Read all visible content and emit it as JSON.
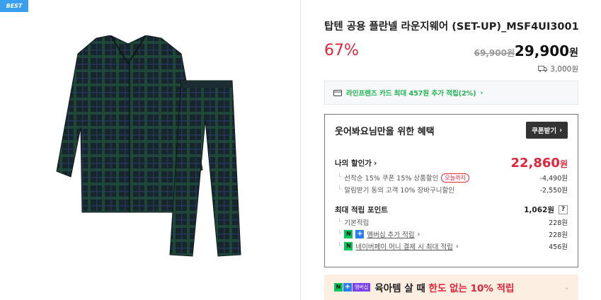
{
  "badge": "BEST",
  "product": {
    "title": "탑텐 공용 플란넬 라운지웨어 (SET-UP)_MSF4UI3001",
    "discount": "67%",
    "original_price": "69,900원",
    "sale_price": "29,900",
    "sale_price_unit": "원",
    "delivery_fee": "3,000원",
    "delivery_icon": "truck-icon"
  },
  "card_promo": {
    "text": "라인프렌즈 카드 최대 457원 추가 적립(2%)",
    "chevron": "›",
    "icon": "credit-card-icon"
  },
  "benefit": {
    "title": "웃어봐요님만을 위한 혜택",
    "coupon_button": "쿠폰받기",
    "coupon_chevron": "›",
    "my_discount_label": "나의 할인가",
    "my_discount_chevron": "›",
    "my_discount_price": "22,860",
    "my_discount_unit": "원",
    "discount_items": [
      {
        "label": "선착순 15% 쿠폰 15% 상품할인",
        "tag": "오늘까지",
        "value": "-4,490원"
      },
      {
        "label": "알림받기 동의 고객 10% 장바구니할인",
        "value": "-2,550원"
      }
    ],
    "points_label": "최대 적립 포인트",
    "points_value": "1,062원",
    "points_help": "?",
    "point_items": [
      {
        "label": "기본적립",
        "value": "228원"
      },
      {
        "label": "멤버십 추가 적립",
        "value": "228원",
        "badge_n": "N",
        "badge_plus": "+"
      },
      {
        "label": "네이버페이 머니 결제 시 최대 적립",
        "value": "456원",
        "badge_n": "N"
      }
    ]
  },
  "banner": {
    "logo_n": "N",
    "logo_plus": "+",
    "logo_membership": "멤버십",
    "text_prefix": "육아템 살 때 ",
    "text_highlight": "한도 없는 10% 적립",
    "chevron": "⌄"
  }
}
